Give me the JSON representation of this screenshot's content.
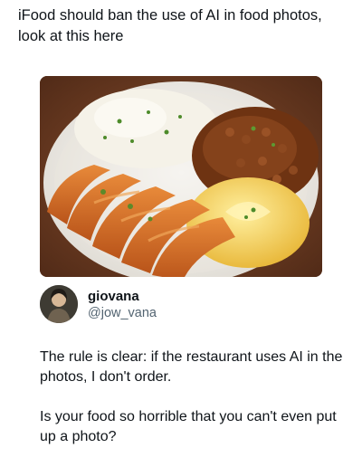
{
  "caption": {
    "text": "iFood should ban the use of AI in food photos, look at this here"
  },
  "photo": {
    "subject": "food-plate-photo",
    "colors": {
      "table": "#6a3b22",
      "plate": "#f3f1ec",
      "rice": "#f4f1e6",
      "beans": "#7a3b17",
      "cutlet": "#d66f25",
      "mash": "#f2cf58",
      "herbs": "#3f7a23"
    }
  },
  "author": {
    "name": "giovana",
    "handle": "@jow_vana",
    "avatar_icon": "profile-photo-avatar"
  },
  "post": {
    "paragraph_1": "The rule is clear: if the restaurant uses AI in the photos, I don't order.",
    "paragraph_2": "Is your food so horrible that you can't even put up a photo?"
  }
}
